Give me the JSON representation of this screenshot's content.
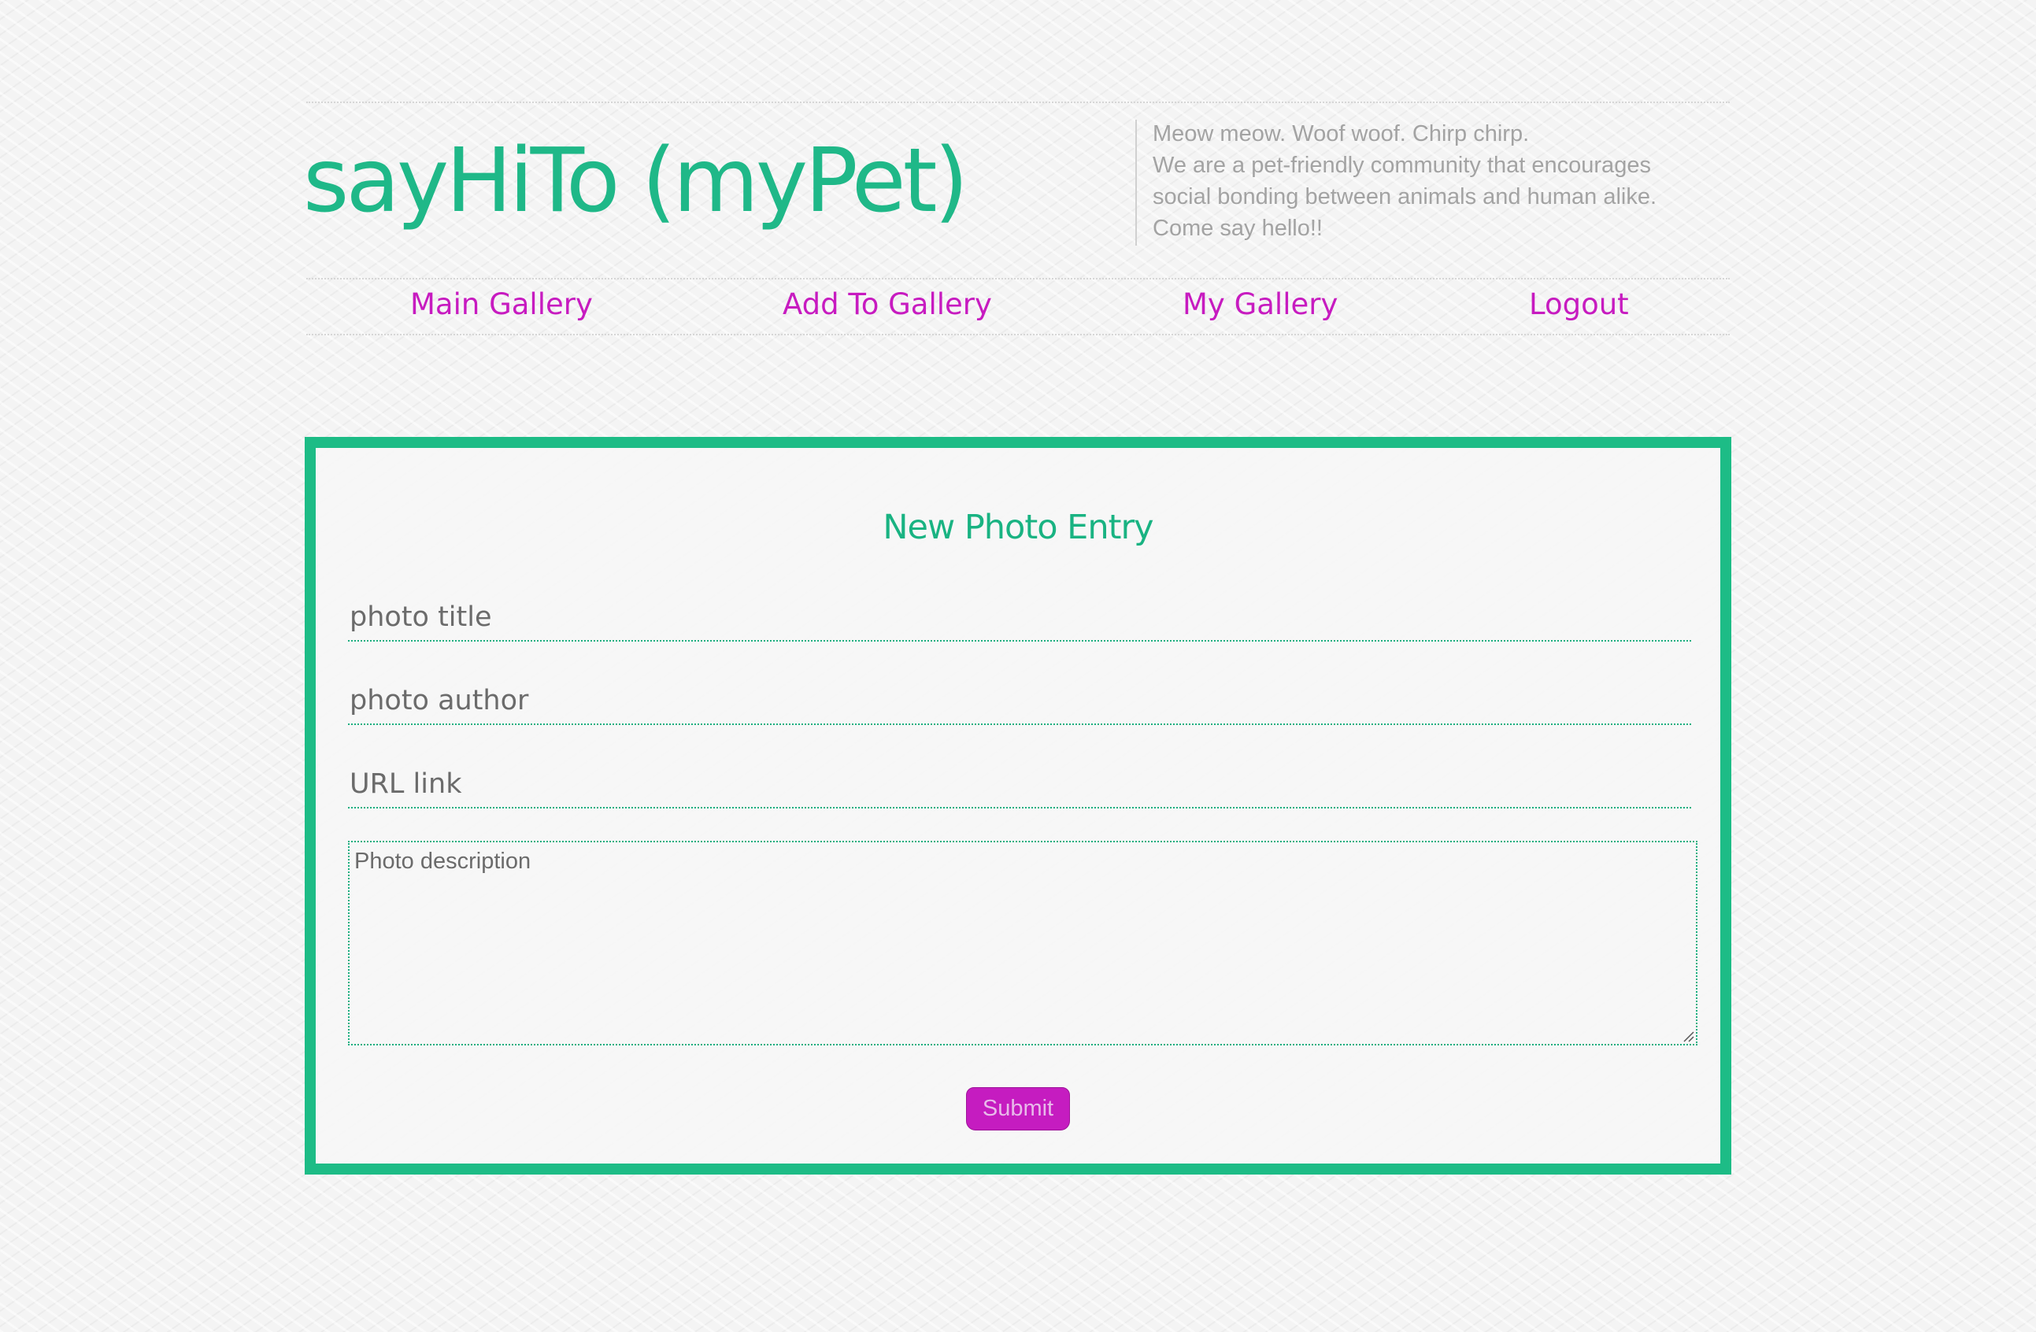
{
  "header": {
    "site_title": "sayHiTo (myPet)",
    "tagline_lines": [
      "Meow meow. Woof woof. Chirp chirp.",
      "We are a pet-friendly community that encourages",
      "social bonding between animals and human alike.",
      "Come say hello!!"
    ]
  },
  "nav": {
    "items": [
      {
        "label": "Main Gallery"
      },
      {
        "label": "Add To Gallery"
      },
      {
        "label": "My Gallery"
      },
      {
        "label": "Logout"
      }
    ]
  },
  "form": {
    "title": "New Photo Entry",
    "title_placeholder": "photo title",
    "author_placeholder": "photo author",
    "url_placeholder": "URL link",
    "description_placeholder": "Photo description",
    "submit_label": "Submit"
  },
  "colors": {
    "brand_green": "#1dbc86",
    "nav_magenta": "#c71bc0",
    "tagline_gray": "#a3a3a3"
  }
}
